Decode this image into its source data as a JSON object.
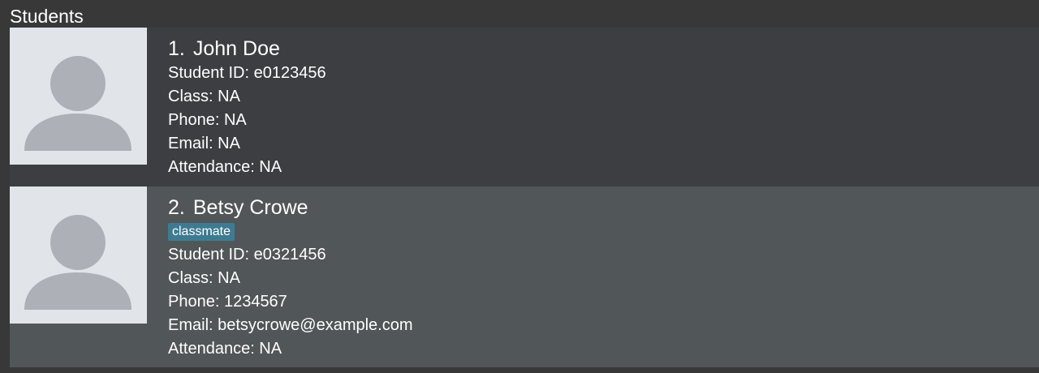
{
  "panel": {
    "title": "Students"
  },
  "students": [
    {
      "index": "1.",
      "name": "John Doe",
      "tags": [],
      "student_id": "Student ID: e0123456",
      "class": "Class: NA",
      "phone": "Phone: NA",
      "email": "Email: NA",
      "attendance": "Attendance: NA",
      "avatar_icon": "person-silhouette-icon"
    },
    {
      "index": "2.",
      "name": "Betsy Crowe",
      "tags": [
        "classmate"
      ],
      "student_id": "Student ID: e0321456",
      "class": "Class: NA",
      "phone": "Phone: 1234567",
      "email": "Email: betsycrowe@example.com",
      "attendance": "Attendance: NA",
      "avatar_icon": "person-silhouette-icon"
    }
  ],
  "colors": {
    "background": "#383838",
    "card_default": "#3d3e42",
    "card_selected": "#515658",
    "tag": "#3e7b91",
    "avatar_bg": "#e1e4e8",
    "avatar_fg": "#adb1b7"
  }
}
